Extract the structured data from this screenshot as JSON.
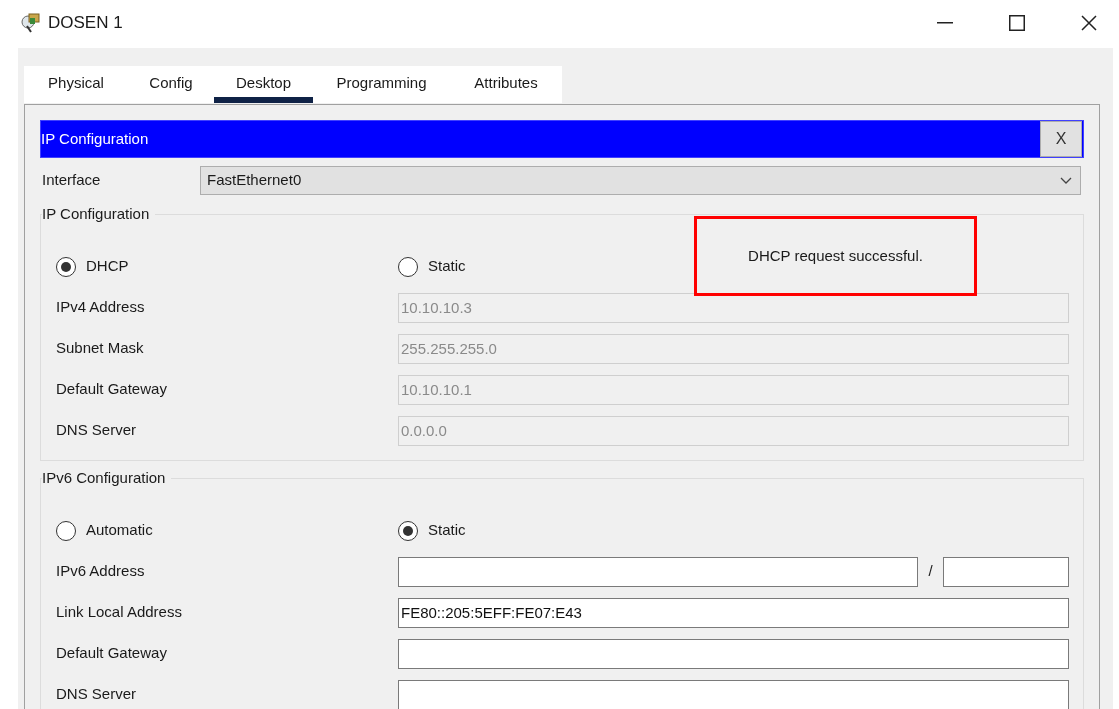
{
  "window": {
    "title": "DOSEN 1"
  },
  "tabs": [
    {
      "label": "Physical",
      "selected": false
    },
    {
      "label": "Config",
      "selected": false
    },
    {
      "label": "Desktop",
      "selected": true
    },
    {
      "label": "Programming",
      "selected": false
    },
    {
      "label": "Attributes",
      "selected": false
    }
  ],
  "dialog": {
    "title": "IP Configuration",
    "close_label": "X"
  },
  "interface": {
    "label": "Interface",
    "value": "FastEthernet0"
  },
  "ipv4": {
    "legend": "IP Configuration",
    "modes": [
      {
        "label": "DHCP",
        "selected": true
      },
      {
        "label": "Static",
        "selected": false
      }
    ],
    "status_message": {
      "text": "DHCP request successful.",
      "highlighted": true
    },
    "fields": [
      {
        "label": "IPv4 Address",
        "value": "10.10.10.3",
        "disabled": true
      },
      {
        "label": "Subnet Mask",
        "value": "255.255.255.0",
        "disabled": true
      },
      {
        "label": "Default Gateway",
        "value": "10.10.10.1",
        "disabled": true
      },
      {
        "label": "DNS Server",
        "value": "0.0.0.0",
        "disabled": true
      }
    ]
  },
  "ipv6": {
    "legend": "IPv6 Configuration",
    "modes": [
      {
        "label": "Automatic",
        "selected": false
      },
      {
        "label": "Static",
        "selected": true
      }
    ],
    "fields": [
      {
        "label": "IPv6 Address",
        "kind": "prefixed",
        "separator": "/",
        "disabled": false
      },
      {
        "label": "Link Local Address",
        "kind": "plain",
        "value": "FE80::205:5EFF:FE07:E43",
        "disabled": false
      },
      {
        "label": "Default Gateway",
        "kind": "plain",
        "disabled": false
      },
      {
        "label": "DNS Server",
        "kind": "plain",
        "disabled": false
      }
    ]
  }
}
